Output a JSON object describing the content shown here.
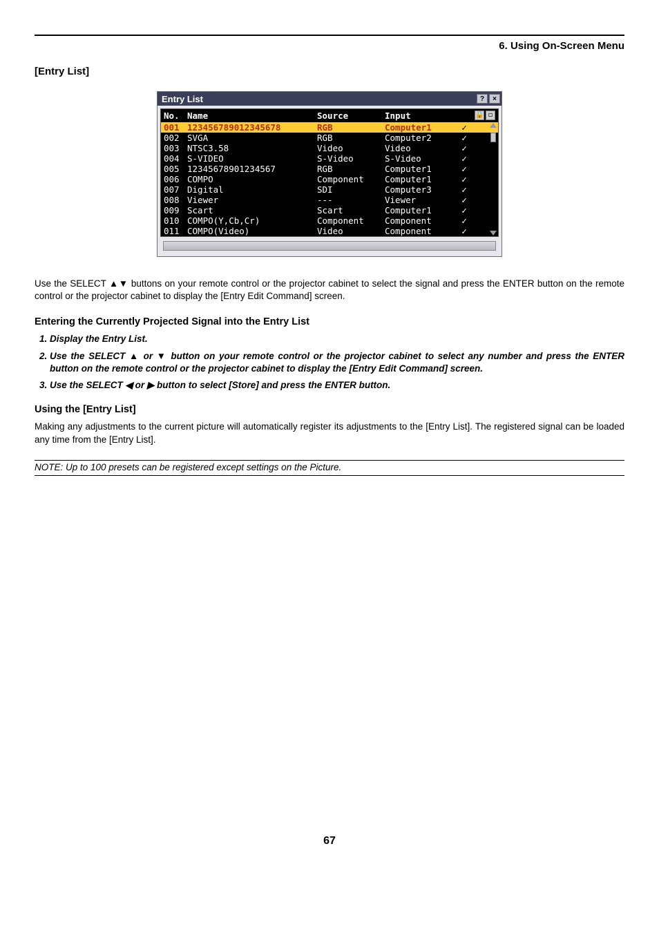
{
  "chapter": "6. Using On-Screen Menu",
  "section_title": "[Entry List]",
  "window": {
    "title": "Entry List",
    "help_btn": "?",
    "close_btn": "×",
    "lock_icon": "🔒",
    "disp_icon": "◻",
    "headers": {
      "no": "No.",
      "name": "Name",
      "source": "Source",
      "input": "Input"
    },
    "rows": [
      {
        "no": "001",
        "name": "123456789012345678",
        "source": "RGB",
        "input": "Computer1",
        "check": "✓",
        "hl": true
      },
      {
        "no": "002",
        "name": "SVGA",
        "source": "RGB",
        "input": "Computer2",
        "check": "✓",
        "hl": false
      },
      {
        "no": "003",
        "name": "NTSC3.58",
        "source": "Video",
        "input": "Video",
        "check": "✓",
        "hl": false
      },
      {
        "no": "004",
        "name": "S-VIDEO",
        "source": "S-Video",
        "input": "S-Video",
        "check": "✓",
        "hl": false
      },
      {
        "no": "005",
        "name": "12345678901234567",
        "source": "RGB",
        "input": "Computer1",
        "check": "✓",
        "hl": false
      },
      {
        "no": "006",
        "name": "COMPO",
        "source": "Component",
        "input": "Computer1",
        "check": "✓",
        "hl": false
      },
      {
        "no": "007",
        "name": "Digital",
        "source": "SDI",
        "input": "Computer3",
        "check": "✓",
        "hl": false
      },
      {
        "no": "008",
        "name": "Viewer",
        "source": "---",
        "input": "Viewer",
        "check": "✓",
        "hl": false
      },
      {
        "no": "009",
        "name": "Scart",
        "source": "Scart",
        "input": "Computer1",
        "check": "✓",
        "hl": false
      },
      {
        "no": "010",
        "name": "COMPO(Y,Cb,Cr)",
        "source": "Component",
        "input": "Component",
        "check": "✓",
        "hl": false
      },
      {
        "no": "011",
        "name": "COMPO(Video)",
        "source": "Video",
        "input": "Component",
        "check": "✓",
        "hl": false
      }
    ]
  },
  "paragraph1": "Use the SELECT ▲▼ buttons on your remote control or the projector cabinet to select the signal and press the ENTER button on the remote control or the projector cabinet to display the [Entry Edit Command] screen.",
  "heading_entering": "Entering the Currently Projected Signal into the Entry List",
  "steps": [
    "Display the Entry List.",
    "Use the SELECT ▲ or ▼ button on your remote control or the projector cabinet to select any number and press the ENTER button on the remote control or the projector cabinet to display the [Entry Edit Command] screen.",
    "Use the SELECT ◀ or ▶ button to select [Store] and press the ENTER button."
  ],
  "heading_using": "Using the [Entry List]",
  "paragraph2": "Making any adjustments to the current picture will automatically register its adjustments to the [Entry List]. The registered signal can be loaded any time from the [Entry List].",
  "note": "NOTE: Up to 100 presets can be registered except settings on the Picture.",
  "page_number": "67"
}
